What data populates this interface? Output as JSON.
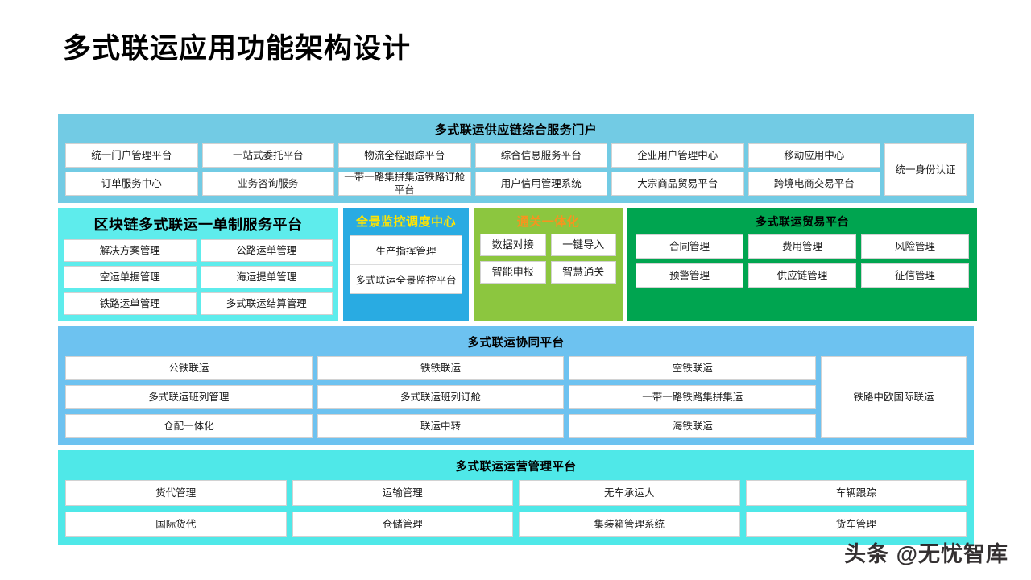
{
  "page": {
    "title": "多式联运应用功能架构设计",
    "watermark": "头条 @无忧智库"
  },
  "colors": {
    "portal_bg": "#72cbe4",
    "blockchain_bg": "#5eecec",
    "monitor_bg": "#29abe2",
    "monitor_title": "#ffe400",
    "customs_bg": "#8cc63f",
    "customs_title": "#f7941e",
    "trade_bg": "#00a550",
    "collab_bg": "#6dc2f0",
    "ops_bg": "#4fe8e8",
    "cell_bg": "#ffffff",
    "cell_border": "#d2d2d2",
    "title_text": "#000000",
    "rule": "#b8b8b8"
  },
  "portal": {
    "title": "多式联运供应链综合服务门户",
    "cells_row1": [
      "统一门户管理平台",
      "一站式委托平台",
      "物流全程跟踪平台",
      "综合信息服务平台",
      "企业用户管理中心",
      "移动应用中心"
    ],
    "cells_row2": [
      "订单服务中心",
      "业务咨询服务",
      "一带一路集拼集运铁路订舱平台",
      "用户信用管理系统",
      "大宗商品贸易平台",
      "跨境电商交易平台"
    ],
    "tall_cell": "统一身份认证"
  },
  "blockchain": {
    "title": "区块链多式联运一单制服务平台",
    "cells": [
      "解决方案管理",
      "公路运单管理",
      "空运单据管理",
      "海运提单管理",
      "铁路运单管理",
      "多式联运结算管理"
    ]
  },
  "monitor": {
    "title": "全景监控调度中心",
    "cells": [
      "生产指挥管理",
      "多式联运全景监控平台"
    ]
  },
  "customs": {
    "title": "通关一体化",
    "cells": [
      "数据对接",
      "一键导入",
      "智能申报",
      "智慧通关"
    ]
  },
  "trade": {
    "title": "多式联运贸易平台",
    "cells": [
      "合同管理",
      "费用管理",
      "风险管理",
      "预警管理",
      "供应链管理",
      "征信管理"
    ]
  },
  "collab": {
    "title": "多式联运协同平台",
    "cells": [
      "公铁联运",
      "铁铁联运",
      "空铁联运",
      "多式联运班列管理",
      "多式联运班列订舱",
      "一带一路铁路集拼集运",
      "仓配一体化",
      "联运中转",
      "海铁联运"
    ],
    "tall_cell": "铁路中欧国际联运"
  },
  "ops": {
    "title": "多式联运运营管理平台",
    "cells": [
      "货代管理",
      "运输管理",
      "无车承运人",
      "车辆跟踪",
      "国际货代",
      "仓储管理",
      "集装箱管理系统",
      "货车管理"
    ]
  }
}
